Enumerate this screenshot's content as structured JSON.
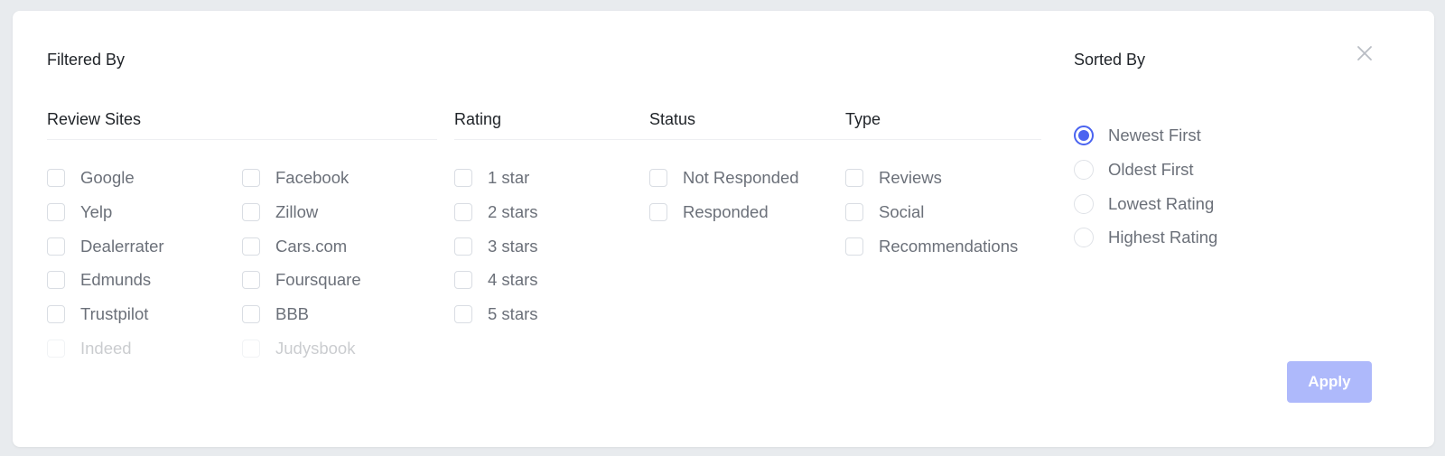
{
  "filter": {
    "title": "Filtered By",
    "review_sites": {
      "header": "Review Sites",
      "col1": [
        "Google",
        "Yelp",
        "Dealerrater",
        "Edmunds",
        "Trustpilot",
        "Indeed"
      ],
      "col2": [
        "Facebook",
        "Zillow",
        "Cars.com",
        "Foursquare",
        "BBB",
        "Judysbook"
      ]
    },
    "rating": {
      "header": "Rating",
      "options": [
        "1 star",
        "2 stars",
        "3 stars",
        "4 stars",
        "5 stars"
      ]
    },
    "status": {
      "header": "Status",
      "options": [
        "Not Responded",
        "Responded"
      ]
    },
    "type": {
      "header": "Type",
      "options": [
        "Reviews",
        "Social",
        "Recommendations"
      ]
    }
  },
  "sort": {
    "title": "Sorted By",
    "options": [
      "Newest First",
      "Oldest First",
      "Lowest Rating",
      "Highest Rating"
    ],
    "selected": "Newest First"
  },
  "actions": {
    "apply_label": "Apply",
    "close_icon": "close-icon"
  },
  "colors": {
    "accent": "#4a63f0",
    "apply_disabled_bg": "#aeb9fb"
  }
}
